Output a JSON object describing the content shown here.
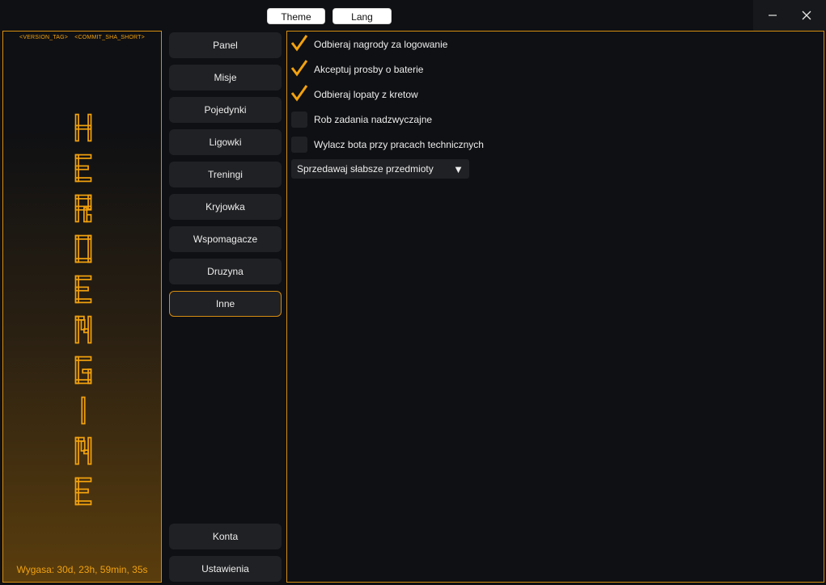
{
  "topbar": {
    "theme_label": "Theme",
    "lang_label": "Lang"
  },
  "sidebar": {
    "version_tag": "<VERSION_TAG>",
    "commit_sha": "<COMMIT_SHA_SHORT>",
    "logo_text": "HEROENGINE",
    "expiry": "Wygasa: 30d, 23h, 59min, 35s"
  },
  "nav": {
    "items": [
      "Panel",
      "Misje",
      "Pojedynki",
      "Ligowki",
      "Treningi",
      "Kryjowka",
      "Wspomagacze",
      "Druzyna",
      "Inne"
    ],
    "bottom": [
      "Konta",
      "Ustawienia"
    ],
    "active": "Inne"
  },
  "options": [
    {
      "label": "Odbieraj nagrody za logowanie",
      "checked": true
    },
    {
      "label": "Akceptuj prosby o baterie",
      "checked": true
    },
    {
      "label": "Odbieraj lopaty z kretow",
      "checked": true
    },
    {
      "label": "Rob zadania nadzwyczajne",
      "checked": false
    },
    {
      "label": "Wylacz bota przy pracach technicznych",
      "checked": false
    }
  ],
  "dropdown": {
    "selected": "Sprzedawaj słabsze przedmioty",
    "caret": "▼"
  },
  "colors": {
    "accent": "#f2a20f",
    "border": "#d68d11",
    "bg": "#0f1013",
    "button": "#202124"
  },
  "icons": {
    "minimize": "minimize-icon",
    "close": "close-icon",
    "check": "checkmark-icon",
    "caret": "caret-down-icon"
  }
}
